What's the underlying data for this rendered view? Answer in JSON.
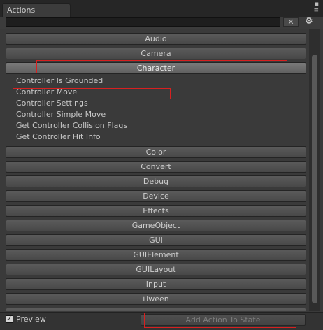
{
  "window": {
    "tab_title": "Actions",
    "menu_icon": "menu-dots-icon",
    "lock_icon": "lock-icon"
  },
  "toolbar": {
    "search_value": "",
    "clear_label": "✕",
    "settings_icon": "gear-icon"
  },
  "categories_top": [
    "Audio",
    "Camera",
    "Character"
  ],
  "expanded_category": "Character",
  "actions": [
    "Controller Is Grounded",
    "Controller Move",
    "Controller Settings",
    "Controller Simple Move",
    "Get Controller Collision Flags",
    "Get Controller Hit Info"
  ],
  "categories_bottom": [
    "Color",
    "Convert",
    "Debug",
    "Device",
    "Effects",
    "GameObject",
    "GUI",
    "GUIElement",
    "GUILayout",
    "Input",
    "iTween"
  ],
  "footer": {
    "preview_checked": true,
    "preview_label": "Preview",
    "add_button_label": "Add Action To State"
  },
  "colors": {
    "highlight": "#d82020",
    "panel_bg": "#3a3a3a",
    "category_bg": "#515151"
  }
}
